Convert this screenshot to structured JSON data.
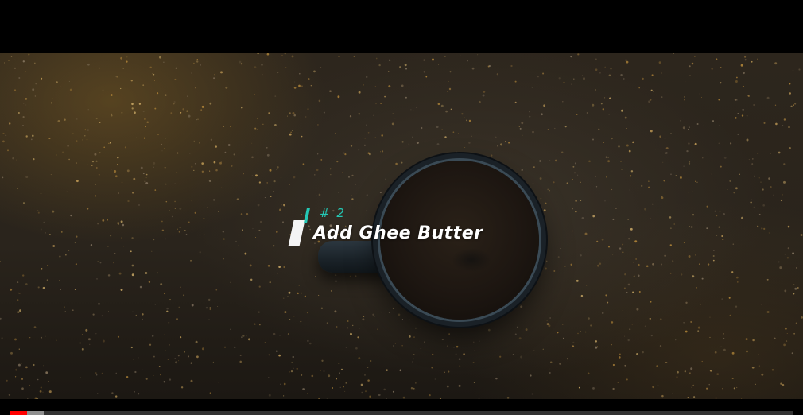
{
  "video": {
    "overlay_number": "# 2",
    "overlay_title": "Add Ghee Butter"
  },
  "progress": {
    "played_fraction": 0.022,
    "buffered_fraction": 0.044,
    "played_color": "#ff0000"
  },
  "colors": {
    "accent_teal": "#24c7b4",
    "title_white": "#ffffff"
  }
}
